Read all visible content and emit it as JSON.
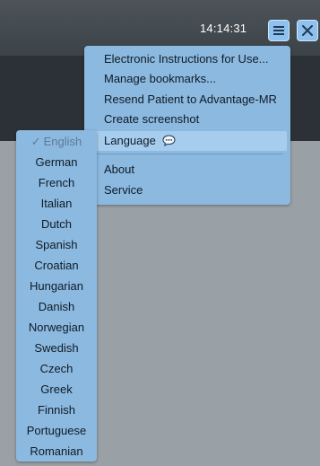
{
  "header": {
    "time": "14:14:31"
  },
  "menu": {
    "items": [
      {
        "label": "Electronic Instructions for Use..."
      },
      {
        "label": "Manage bookmarks..."
      },
      {
        "label": "Resend Patient to Advantage-MR"
      },
      {
        "label": "Create screenshot"
      },
      {
        "label": "Language",
        "icon": "speech-bubble-icon"
      },
      {
        "label": "About"
      },
      {
        "label": "Service"
      }
    ]
  },
  "language_menu": {
    "check_mark": "✓",
    "items": [
      {
        "label": "English",
        "selected": true
      },
      {
        "label": "German"
      },
      {
        "label": "French"
      },
      {
        "label": "Italian"
      },
      {
        "label": "Dutch"
      },
      {
        "label": "Spanish"
      },
      {
        "label": "Croatian"
      },
      {
        "label": "Hungarian"
      },
      {
        "label": "Danish"
      },
      {
        "label": "Norwegian"
      },
      {
        "label": "Swedish"
      },
      {
        "label": "Czech"
      },
      {
        "label": "Greek"
      },
      {
        "label": "Finnish"
      },
      {
        "label": "Portuguese"
      },
      {
        "label": "Romanian"
      }
    ]
  },
  "colors": {
    "accent": "#8fc1ee",
    "menu_bg": "#8cb9df",
    "highlight": "#a7cdee",
    "topbar": "#434a50",
    "background": "#9aa1a6"
  }
}
